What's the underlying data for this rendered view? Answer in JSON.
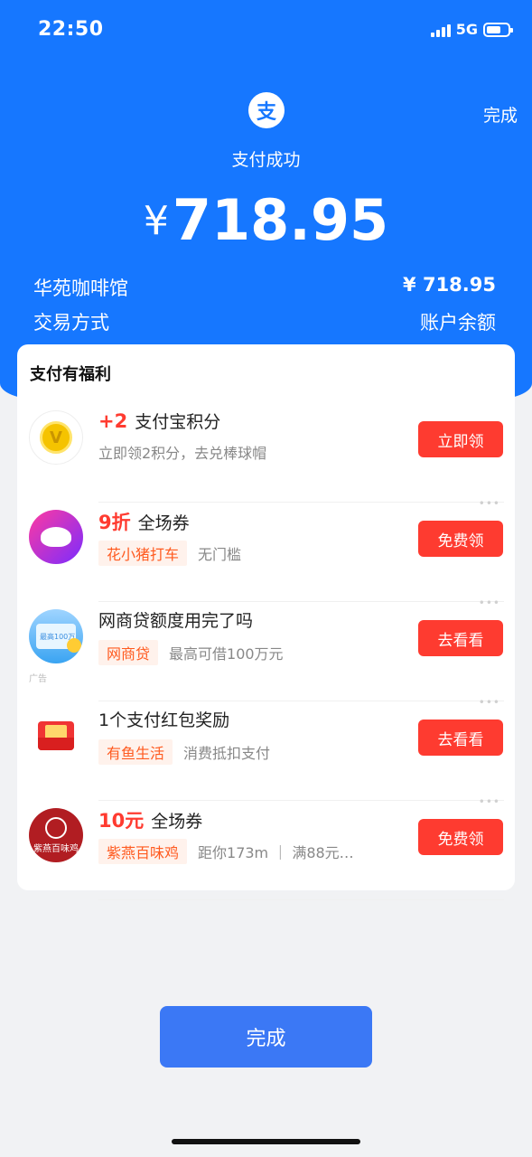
{
  "status_bar": {
    "time": "22:50",
    "network": "5G",
    "battery_level": 0.7
  },
  "header": {
    "logo_glyph": "支",
    "done_label": "完成",
    "status": "支付成功",
    "currency": "¥",
    "amount": "718.95",
    "merchant": "华苑咖啡馆",
    "method_label": "交易方式",
    "balance_amount": "¥ 718.95",
    "balance_label": "账户余额"
  },
  "benefits": {
    "title": "支付有福利",
    "items": [
      {
        "highlight": "+2",
        "title": "支付宝积分",
        "tag": "",
        "desc": "立即领2积分，去兑棒球帽",
        "button": "立即领",
        "icon": "points-coin-icon"
      },
      {
        "highlight": "9折",
        "title": "全场券",
        "tag": "花小猪打车",
        "desc": "无门槛",
        "button": "免费领",
        "icon": "pig-logo-icon"
      },
      {
        "highlight": "",
        "title": "网商贷额度用完了吗",
        "tag": "网商贷",
        "desc": "最高可借100万元",
        "button": "去看看",
        "icon": "loan-card-icon",
        "ad_label": "广告",
        "icon_text": "最高100万"
      },
      {
        "highlight": "",
        "title": "1个支付红包奖励",
        "tag": "有鱼生活",
        "desc": "消费抵扣支付",
        "button": "去看看",
        "icon": "red-envelope-icon"
      },
      {
        "highlight": "10元",
        "title": "全场券",
        "tag": "紫燕百味鸡",
        "desc": "距你173m ｜ 满88元…",
        "button": "免费领",
        "icon": "ziyan-logo-icon",
        "icon_text": "紫燕百味鸡"
      }
    ],
    "more_glyph": "•••"
  },
  "footer": {
    "done_label": "完成"
  }
}
